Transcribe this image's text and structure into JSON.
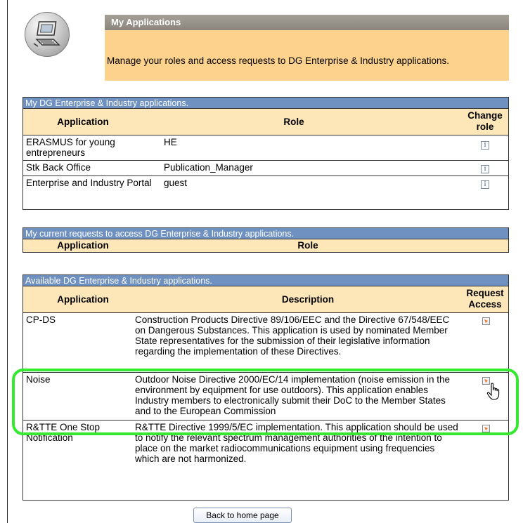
{
  "header": {
    "title": "My Applications",
    "description": "Manage your roles and access requests to DG Enterprise & Industry applications.",
    "logo_icon": "computer-icon"
  },
  "my_apps": {
    "title": "My DG Enterprise & Industry applications.",
    "columns": {
      "application": "Application",
      "role": "Role",
      "change_role": "Change role"
    },
    "rows": [
      {
        "application": "ERASMUS for young entrepreneurs",
        "role": "HE"
      },
      {
        "application": "Stk Back Office",
        "role": "Publication_Manager"
      },
      {
        "application": "Enterprise and Industry Portal",
        "role": "guest"
      }
    ],
    "change_icon_glyph": "i"
  },
  "requests": {
    "title": "My current requests to access DG Enterprise & Industry applications.",
    "columns": {
      "application": "Application",
      "role": "Role"
    }
  },
  "available": {
    "title": "Available DG Enterprise & Industry applications.",
    "columns": {
      "application": "Application",
      "description": "Description",
      "request_access": "Request Access"
    },
    "rows": [
      {
        "application": "CP-DS",
        "description": "Construction Products Directive 89/106/EEC and the Directive 67/548/EEC on Dangerous Substances. This application is used by nominated Member State representatives for the submission of their legislative information regarding the implementation of these Directives."
      },
      {
        "application": "Noise",
        "description": "Outdoor Noise Directive 2000/EC/14 implementation (noise emission in the environment by equipment for use outdoors). This application enables Industry members to electronically submit their DoC to the Member States and to the European Commission"
      },
      {
        "application": "R&TTE One Stop Notification",
        "description": "R&TTE Directive 1999/5/EC implementation. This application should be used to notify the relevant spectrum management authorities of the intention to place on the market radiocommunications equipment using frequencies which are not harmonized."
      }
    ]
  },
  "back_button": "Back to home page",
  "colors": {
    "header_bar": "#a5a198",
    "header_desc": "#fcd28c",
    "table_title": "#6f91c1",
    "table_head": "#fde7b8",
    "highlight": "#35e830"
  }
}
